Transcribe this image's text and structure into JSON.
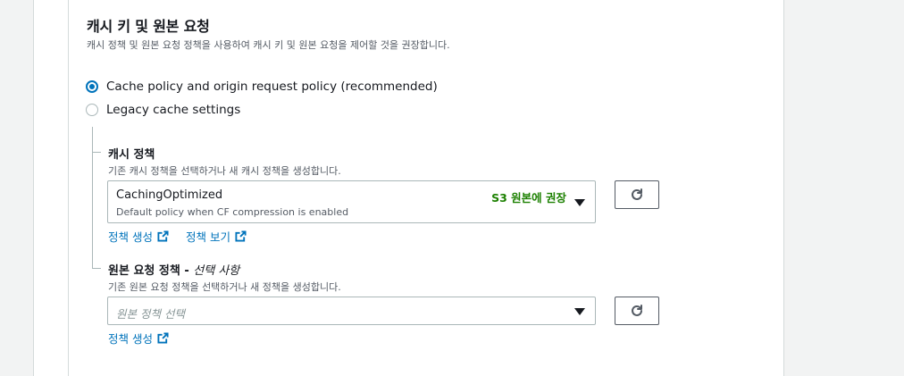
{
  "section": {
    "title": "캐시 키 및 원본 요청",
    "description": "캐시 정책 및 원본 요청 정책을 사용하여 캐시 키 및 원본 요청을 제어할 것을 권장합니다."
  },
  "radio_options": [
    {
      "label": "Cache policy and origin request policy (recommended)",
      "selected": true
    },
    {
      "label": "Legacy cache settings",
      "selected": false
    }
  ],
  "cache_policy": {
    "label": "캐시 정책",
    "description": "기존 캐시 정책을 선택하거나 새 캐시 정책을 생성합니다.",
    "selected_value": "CachingOptimized",
    "selected_description": "Default policy when CF compression is enabled",
    "badge": "S3 원본에 권장",
    "create_link": "정책 생성",
    "view_link": "정책 보기"
  },
  "origin_request_policy": {
    "label": "원본 요청 정책 - ",
    "label_optional": "선택 사항",
    "description": "기존 원본 요청 정책을 선택하거나 새 정책을 생성합니다.",
    "placeholder": "원본 정책 선택",
    "create_link": "정책 생성"
  },
  "colors": {
    "accent": "#0073bb",
    "badge": "#1d8102",
    "border": "#aab7b8"
  },
  "icons": {
    "refresh": "refresh-icon",
    "external": "external-link-icon",
    "caret": "caret-down-icon"
  }
}
